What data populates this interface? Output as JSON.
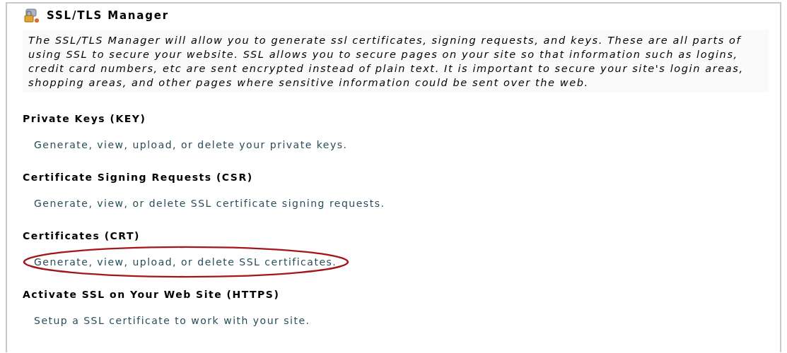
{
  "title": "SSL/TLS Manager",
  "description": "The SSL/TLS Manager will allow you to generate ssl certificates, signing requests, and keys. These are all parts of using SSL to secure your website. SSL allows you to secure pages on your site so that information such as logins, credit card numbers, etc are sent encrypted instead of plain text. It is important to secure your site's login areas, shopping areas, and other pages where sensitive information could be sent over the web.",
  "sections": [
    {
      "heading": "Private Keys (KEY)",
      "link": "Generate, view, upload, or delete your private keys.",
      "highlighted": false
    },
    {
      "heading": "Certificate Signing Requests (CSR)",
      "link": "Generate, view, or delete SSL certificate signing requests.",
      "highlighted": false
    },
    {
      "heading": "Certificates (CRT)",
      "link": "Generate, view, upload, or delete SSL certificates.",
      "highlighted": true
    },
    {
      "heading": "Activate SSL on Your Web Site (HTTPS)",
      "link": "Setup a SSL certificate to work with your site.",
      "highlighted": false
    }
  ]
}
